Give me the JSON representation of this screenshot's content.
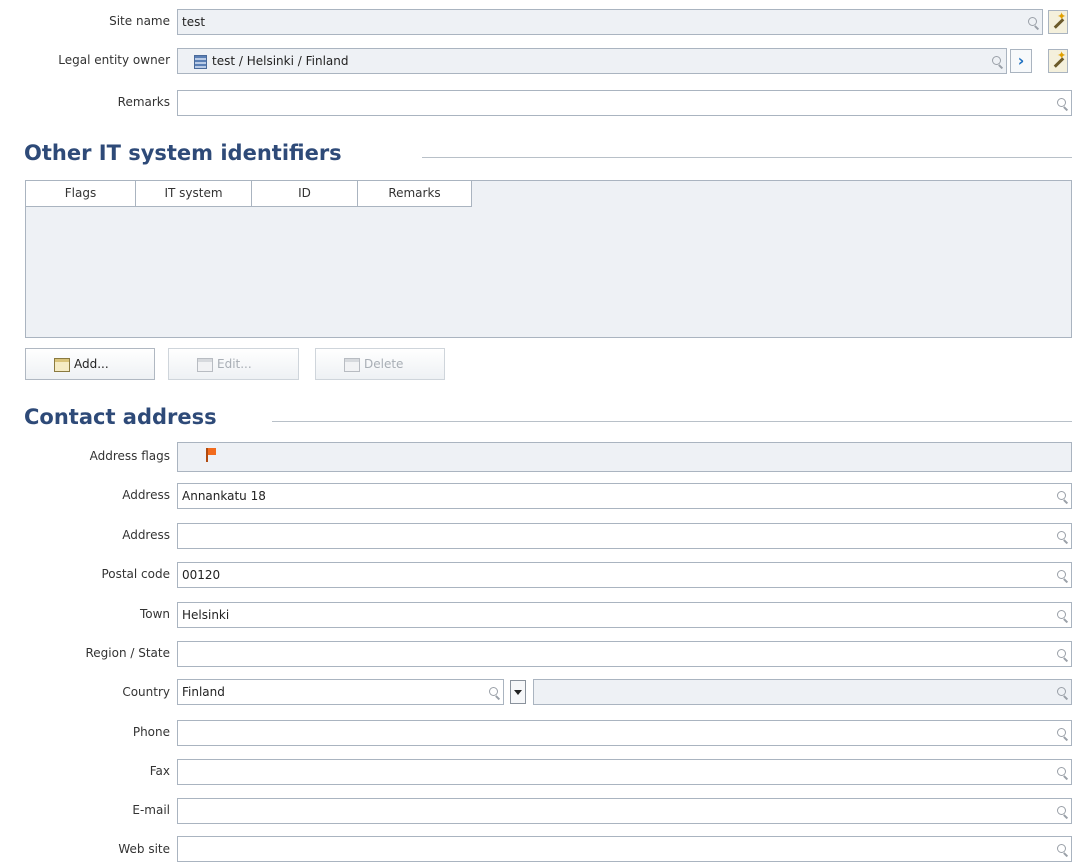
{
  "fields_top": {
    "site_name": {
      "label": "Site name",
      "value": "test"
    },
    "legal_entity_owner": {
      "label": "Legal entity owner",
      "value": "test / Helsinki / Finland"
    },
    "remarks": {
      "label": "Remarks",
      "value": ""
    }
  },
  "it_identifiers": {
    "title": "Other IT system identifiers",
    "columns": [
      "Flags",
      "IT system",
      "ID",
      "Remarks"
    ],
    "buttons": {
      "add": "Add...",
      "edit": "Edit...",
      "delete": "Delete"
    }
  },
  "contact_address": {
    "title": "Contact address",
    "address_flags": {
      "label": "Address flags"
    },
    "address1": {
      "label": "Address",
      "value": "Annankatu 18"
    },
    "address2": {
      "label": "Address",
      "value": ""
    },
    "postal_code": {
      "label": "Postal code",
      "value": "00120"
    },
    "town": {
      "label": "Town",
      "value": "Helsinki"
    },
    "region": {
      "label": "Region / State",
      "value": ""
    },
    "country": {
      "label": "Country",
      "value": "Finland"
    },
    "phone": {
      "label": "Phone",
      "value": ""
    },
    "fax": {
      "label": "Fax",
      "value": ""
    },
    "email": {
      "label": "E-mail",
      "value": ""
    },
    "website": {
      "label": "Web site",
      "value": ""
    }
  },
  "icons": [
    "search-icon",
    "wand-icon",
    "next-icon",
    "legal-entity-icon",
    "flag-icon",
    "table-add-icon",
    "table-edit-icon",
    "table-delete-icon",
    "dropdown-arrow-icon"
  ],
  "colors": {
    "section_title": "#2e4a78",
    "border": "#aab4c0",
    "readonly_bg": "#eef1f5",
    "flag": "#f26b1d"
  }
}
